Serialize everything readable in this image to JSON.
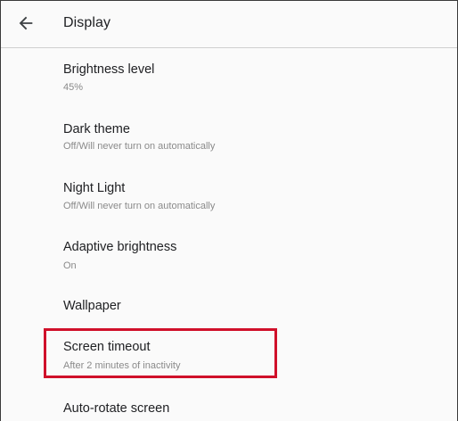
{
  "header": {
    "back_icon": "arrow-back-icon",
    "title": "Display"
  },
  "settings": {
    "items": [
      {
        "title": "Brightness level",
        "subtitle": "45%"
      },
      {
        "title": "Dark theme",
        "subtitle": "Off/Will never turn on automatically"
      },
      {
        "title": "Night Light",
        "subtitle": "Off/Will never turn on automatically"
      },
      {
        "title": "Adaptive brightness",
        "subtitle": "On"
      },
      {
        "title": "Wallpaper"
      },
      {
        "title": "Screen timeout",
        "subtitle": "After 2 minutes of inactivity",
        "highlighted": true
      },
      {
        "title": "Auto-rotate screen"
      }
    ]
  },
  "colors": {
    "highlight": "#d0102a",
    "title_text": "#202124",
    "subtitle_text": "#8a8a8a"
  }
}
